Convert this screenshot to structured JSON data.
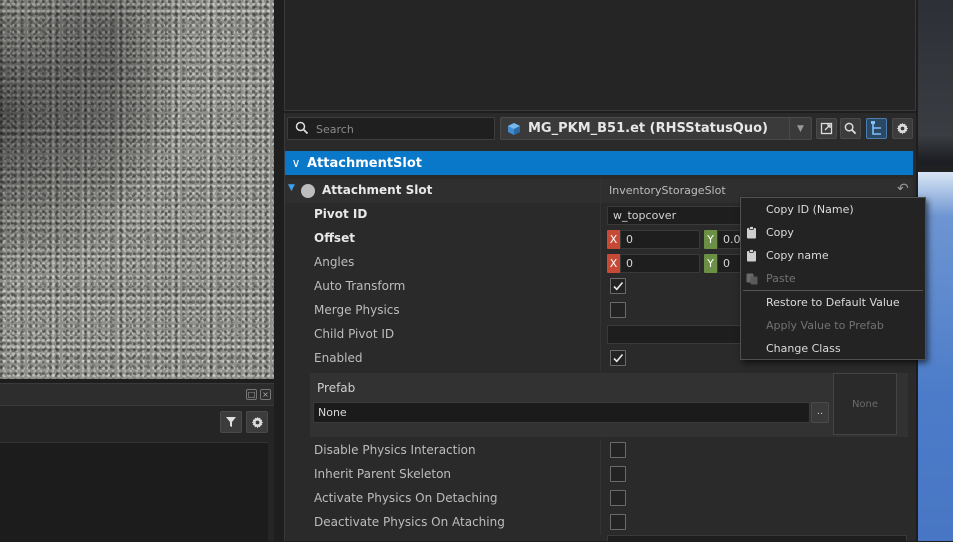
{
  "left_panel": {
    "filter_icon": "filter-icon",
    "settings_icon": "gear-icon"
  },
  "toolbar": {
    "search_placeholder": "Search",
    "entity_name": "MG_PKM_B51.et (RHSStatusQuo)",
    "icons": [
      "search-icon",
      "cube-icon",
      "chevron-down-icon",
      "open-external-icon",
      "magnify-icon",
      "hierarchy-icon",
      "gear-icon"
    ]
  },
  "section": {
    "title": "AttachmentSlot"
  },
  "attachment_slot": {
    "label": "Attachment Slot",
    "value": "InventoryStorageSlot"
  },
  "properties": {
    "pivot_id": {
      "label": "Pivot ID",
      "value": "w_topcover"
    },
    "offset": {
      "label": "Offset",
      "x_axis": "X",
      "x_value": "0",
      "y_axis": "Y",
      "y_value": "0.05"
    },
    "angles": {
      "label": "Angles",
      "x_axis": "X",
      "x_value": "0",
      "y_axis": "Y",
      "y_value": "0"
    },
    "auto_transform": {
      "label": "Auto Transform",
      "checked": true
    },
    "merge_physics": {
      "label": "Merge Physics",
      "checked": false
    },
    "child_pivot_id": {
      "label": "Child Pivot ID",
      "value": ""
    },
    "enabled": {
      "label": "Enabled",
      "checked": true
    }
  },
  "prefab": {
    "title": "Prefab",
    "value": "None",
    "browse_label": "..",
    "preview_label": "None"
  },
  "lower_properties": [
    {
      "label": "Disable Physics Interaction",
      "checked": false
    },
    {
      "label": "Inherit Parent Skeleton",
      "checked": false
    },
    {
      "label": "Activate Physics On Detaching",
      "checked": false
    },
    {
      "label": "Deactivate Physics On Ataching",
      "checked": false
    }
  ],
  "context_menu": {
    "items": [
      {
        "label": "Copy ID (Name)",
        "icon": "",
        "disabled": false
      },
      {
        "label": "Copy",
        "icon": "clipboard-icon",
        "disabled": false
      },
      {
        "label": "Copy name",
        "icon": "clipboard-icon",
        "disabled": false
      },
      {
        "label": "Paste",
        "icon": "paste-icon",
        "disabled": true
      },
      {
        "label": "Restore to Default Value",
        "icon": "",
        "disabled": false
      },
      {
        "label": "Apply Value to Prefab",
        "icon": "",
        "disabled": true
      },
      {
        "label": "Change Class",
        "icon": "",
        "disabled": false
      }
    ]
  },
  "colors": {
    "section_header": "#0a78c8",
    "axis_x": "#c64a36",
    "axis_y": "#6a8f45"
  }
}
